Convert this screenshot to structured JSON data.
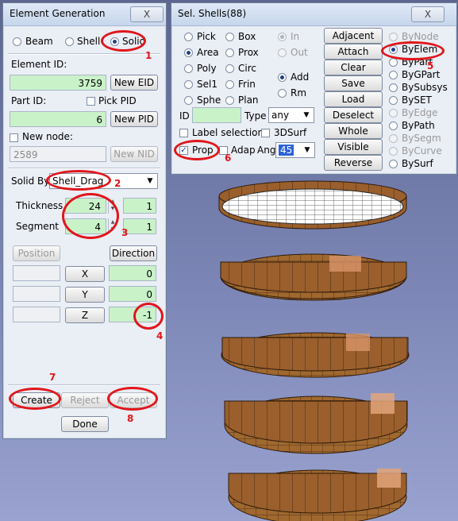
{
  "elementGeneration": {
    "title": "Element Generation",
    "close": "X",
    "types": [
      "Beam",
      "Shell",
      "Solid"
    ],
    "selectedType": "Solid",
    "elementIdLabel": "Element ID:",
    "elementIdValue": "3759",
    "newEidButton": "New EID",
    "partIdLabel": "Part ID:",
    "pickPidLabel": "Pick PID",
    "partIdValue": "6",
    "newPidButton": "New PID",
    "newNodeLabel": "New node:",
    "newNodeValue": "2589",
    "newNidButton": "New NID",
    "solidByLabel": "Solid By",
    "solidByValue": "Shell_Drag",
    "thicknessLabel": "Thickness",
    "thicknessValue": "24",
    "thicknessRight": "1",
    "segmentLabel": "Segment",
    "segmentValue": "4",
    "segmentRight": "1",
    "positionButton": "Position",
    "directionButton": "Direction",
    "xButton": "X",
    "xValue": "0",
    "yButton": "Y",
    "yValue": "0",
    "zButton": "Z",
    "zValue": "-1",
    "createButton": "Create",
    "rejectButton": "Reject",
    "acceptButton": "Accept",
    "doneButton": "Done"
  },
  "selShells": {
    "title": "Sel. Shells(88)",
    "close": "X",
    "methodLeft": [
      "Pick",
      "Area",
      "Poly",
      "Sel1",
      "Sphe"
    ],
    "methodMid": [
      "Box",
      "Prox",
      "Circ",
      "Frin",
      "Plan"
    ],
    "inLabel": "In",
    "outLabel": "Out",
    "addLabel": "Add",
    "rmLabel": "Rm",
    "buttons": [
      "Adjacent",
      "Attach",
      "Clear",
      "Save",
      "Load",
      "Deselect",
      "Whole",
      "Visible",
      "Reverse"
    ],
    "byOptions": [
      "ByNode",
      "ByElem",
      "ByPart",
      "ByGPart",
      "BySubsys",
      "BySET",
      "ByEdge",
      "ByPath",
      "BySegm",
      "ByCurve",
      "BySurf"
    ],
    "idLabel": "ID",
    "typeLabel": "Type",
    "typeValue": "any",
    "labelSelection": "Label selection",
    "surf3d": "3DSurf",
    "propLabel": "Prop",
    "adapLabel": "Adap",
    "angLabel": "Ang",
    "angValue": "45"
  },
  "annotations": [
    "1",
    "2",
    "3",
    "4",
    "5",
    "6",
    "7",
    "8"
  ]
}
